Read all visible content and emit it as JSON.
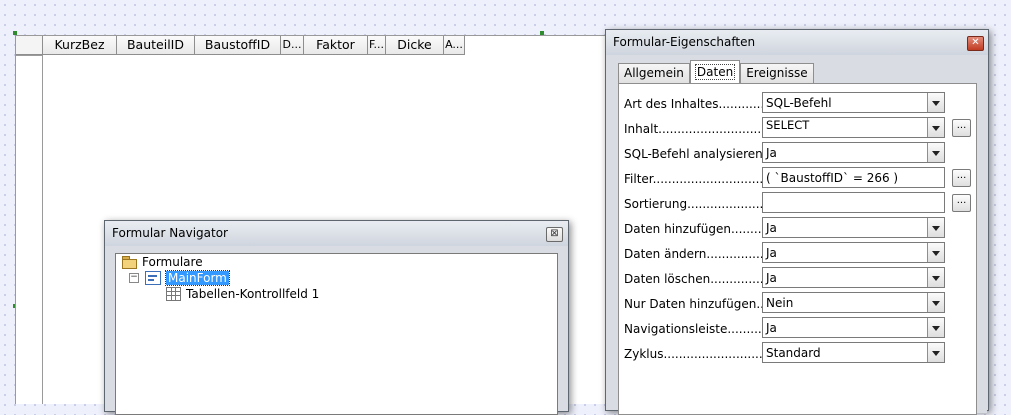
{
  "grid": {
    "columns": [
      "KurzBez",
      "BauteilID",
      "BaustoffID",
      "D...",
      "Faktor",
      "F...",
      "Dicke",
      "A..."
    ]
  },
  "navigator": {
    "title": "Formular Navigator",
    "close_glyph": "⊠",
    "root_label": "Formulare",
    "form_label": "MainForm",
    "expander_glyph": "−",
    "control_label": "Tabellen-Kontrollfeld 1"
  },
  "properties": {
    "title": "Formular-Eigenschaften",
    "close_glyph": "✕",
    "tabs": [
      "Allgemein",
      "Daten",
      "Ereignisse"
    ],
    "more_glyph": "...",
    "rows": [
      {
        "label": "Art des Inhaltes..................",
        "value": "SQL-Befehl"
      },
      {
        "label": "Inhalt...................................",
        "value": "SELECT"
      },
      {
        "label": "SQL-Befehl analysieren.....",
        "value": "Ja"
      },
      {
        "label": "Filter......................................",
        "value": "( `BaustoffID` = 266 )"
      },
      {
        "label": "Sortierung..............................",
        "value": ""
      },
      {
        "label": "Daten hinzufügen..............",
        "value": "Ja"
      },
      {
        "label": "Daten ändern.........................",
        "value": "Ja"
      },
      {
        "label": "Daten löschen.......................",
        "value": "Ja"
      },
      {
        "label": "Nur Daten hinzufügen.......",
        "value": "Nein"
      },
      {
        "label": "Navigationsleiste...............",
        "value": "Ja"
      },
      {
        "label": "Zyklus.........................................",
        "value": "Standard"
      }
    ]
  }
}
